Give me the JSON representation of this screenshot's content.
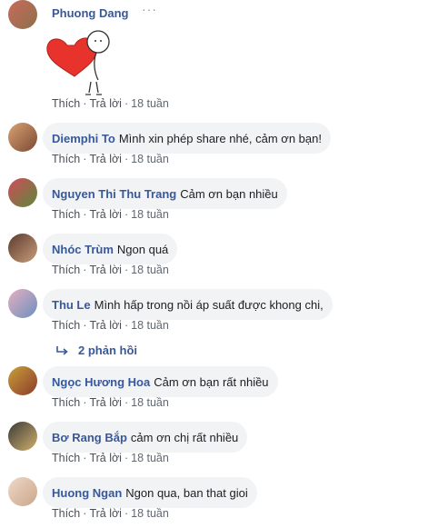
{
  "comments": [
    {
      "name": "Phuong Dang",
      "text": "",
      "has_sticker": true,
      "more_icon": "···",
      "actions": {
        "like": "Thích",
        "reply": "Trả lời",
        "time": "18 tuần"
      },
      "avatar_colors": [
        "#c86b5a",
        "#8e6f4d"
      ]
    },
    {
      "name": "Diemphi To",
      "text": "Mình xin phép share nhé, cảm ơn bạn!",
      "actions": {
        "like": "Thích",
        "reply": "Trả lời",
        "time": "18 tuần"
      },
      "avatar_colors": [
        "#d9a273",
        "#7a4a33"
      ]
    },
    {
      "name": "Nguyen Thi Thu Trang",
      "text": "Cảm ơn bạn nhiều",
      "actions": {
        "like": "Thích",
        "reply": "Trả lời",
        "time": "18 tuần"
      },
      "avatar_colors": [
        "#d04b5c",
        "#5c8a3a"
      ]
    },
    {
      "name": "Nhóc Trùm",
      "text": "Ngon quá",
      "actions": {
        "like": "Thích",
        "reply": "Trả lời",
        "time": "18 tuần"
      },
      "avatar_colors": [
        "#5b3a2e",
        "#c99d7a"
      ]
    },
    {
      "name": "Thu Le",
      "text": "Mình hấp trong nồi áp suất được khong chi,",
      "actions": {
        "like": "Thích",
        "reply": "Trả lời",
        "time": "18 tuần"
      },
      "avatar_colors": [
        "#e6b0c0",
        "#6b8fbf"
      ]
    },
    {
      "name": "Ngọc Hương Hoa",
      "text": "Cảm ơn bạn rất nhiều",
      "actions": {
        "like": "Thích",
        "reply": "Trả lời",
        "time": "18 tuần"
      },
      "avatar_colors": [
        "#c8a13a",
        "#8c3a2a"
      ]
    },
    {
      "name": "Bơ Rang Bắp",
      "text": "cảm ơn chị rất nhiều",
      "actions": {
        "like": "Thích",
        "reply": "Trả lời",
        "time": "18 tuần"
      },
      "avatar_colors": [
        "#3a3a3a",
        "#d0b06a"
      ]
    },
    {
      "name": "Huong Ngan",
      "text": "Ngon qua, ban that gioi",
      "actions": {
        "like": "Thích",
        "reply": "Trả lời",
        "time": "18 tuần"
      },
      "avatar_colors": [
        "#f0d8c8",
        "#c9a68a"
      ]
    }
  ],
  "replies_link": "2 phản hồi",
  "colors": {
    "name": "#385898",
    "bubble": "#f2f3f5",
    "meta": "#606770",
    "sticker_heart": "#e8332d"
  }
}
